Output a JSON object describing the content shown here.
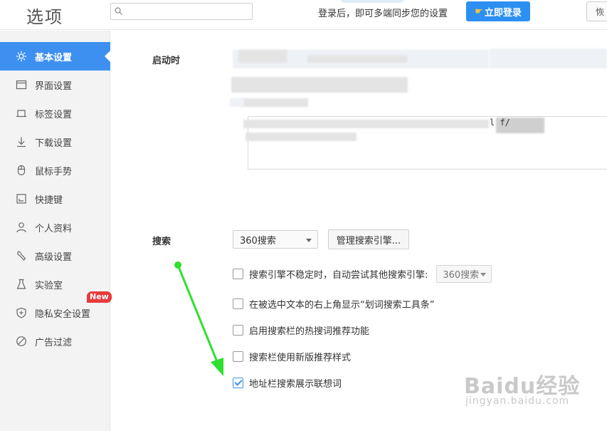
{
  "header": {
    "title": "选项",
    "search_placeholder": "",
    "login_hint": "登录后，即可多端同步您的设置",
    "login_button": "立即登录",
    "restore_button": "恢"
  },
  "sidebar": {
    "items": [
      {
        "label": "基本设置",
        "icon": "gear-icon",
        "active": true
      },
      {
        "label": "界面设置",
        "icon": "window-icon",
        "active": false
      },
      {
        "label": "标签设置",
        "icon": "tab-icon",
        "active": false
      },
      {
        "label": "下载设置",
        "icon": "download-icon",
        "active": false
      },
      {
        "label": "鼠标手势",
        "icon": "mouse-icon",
        "active": false
      },
      {
        "label": "快捷键",
        "icon": "keyboard-icon",
        "active": false
      },
      {
        "label": "个人资料",
        "icon": "person-icon",
        "active": false
      },
      {
        "label": "高级设置",
        "icon": "wrench-icon",
        "active": false
      },
      {
        "label": "实验室",
        "icon": "flask-icon",
        "active": false
      },
      {
        "label": "隐私安全设置",
        "icon": "shield-icon",
        "active": false
      },
      {
        "label": "广告过滤",
        "icon": "block-icon",
        "active": false
      }
    ],
    "new_badge": "New"
  },
  "startup": {
    "label": "启动时",
    "url_tail": "l        f/"
  },
  "search": {
    "label": "搜索",
    "engine_select": "360搜索",
    "manage_button": "管理搜索引擎...",
    "options": [
      {
        "label": "搜索引擎不稳定时，自动尝试其他搜索引擎:",
        "checked": false,
        "select": "360搜索"
      },
      {
        "label": "在被选中文本的右上角显示“划词搜索工具条”",
        "checked": false
      },
      {
        "label": "启用搜索栏的热搜词推荐功能",
        "checked": false
      },
      {
        "label": "搜索栏使用新版推荐样式",
        "checked": false
      },
      {
        "label": "地址栏搜索展示联想词",
        "checked": true
      }
    ]
  },
  "annotation": {
    "arrow_color": "#2ee02e"
  },
  "watermark": {
    "main": "Baidu经验",
    "sub": "jingyan.baidu.com"
  }
}
